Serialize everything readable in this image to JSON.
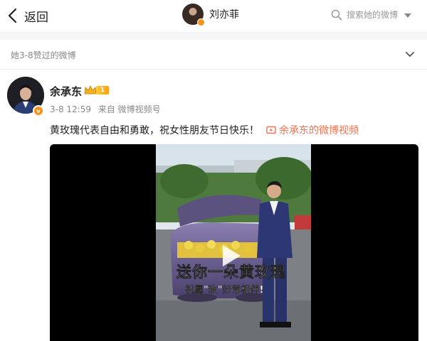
{
  "topbar": {
    "back_label": "返回",
    "profile_name": "刘亦菲",
    "search_placeholder": "搜索她的微博"
  },
  "liked_header": {
    "label": "她3-8赞过的微博"
  },
  "post": {
    "author": "余承东",
    "level": "1",
    "time": "3-8 12:59",
    "source": "来自 微博视频号",
    "text": "黄玫瑰代表自由和勇敢，祝女性朋友节日快乐！",
    "video_link_label": "余承东的微博视频",
    "video": {
      "caption_main": "送你一朵黄玫瑰",
      "caption_sub": "祝愿\"玫\"好常相伴!"
    }
  },
  "colors": {
    "link": "#eb7350",
    "verified_badge": "#f7931a",
    "muted_text": "#888888"
  },
  "icons": [
    "back-chevron-icon",
    "search-icon",
    "dropdown-arrow-icon",
    "expand-chevron-icon",
    "crown-icon",
    "video-link-icon",
    "play-icon"
  ]
}
